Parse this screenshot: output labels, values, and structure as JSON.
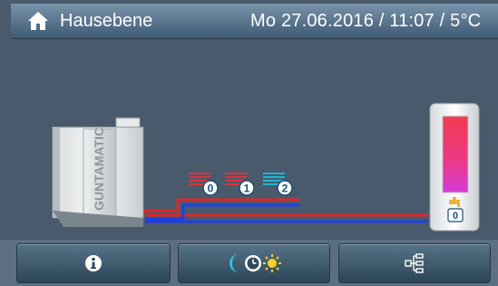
{
  "header": {
    "title": "Hausebene",
    "datetime": "Mo 27.06.2016 / 11:07 /  5°C",
    "home_icon": "home-icon"
  },
  "boiler": {
    "brand": "GUNTAMATIC"
  },
  "heating_circuits": [
    {
      "number": "0",
      "icon": "heating-circuit-icon",
      "color": "#e0303a"
    },
    {
      "number": "1",
      "icon": "heating-circuit-icon",
      "color": "#e0303a"
    },
    {
      "number": "2",
      "icon": "heating-circuit-icon",
      "color": "#1fb4d8"
    }
  ],
  "hot_water_tank": {
    "number": "0",
    "icon": "tap-icon"
  },
  "pipes": {
    "flow_color": "#e1262b",
    "return_color": "#1f3fe0"
  },
  "footer": {
    "buttons": [
      {
        "name": "info",
        "icon": "info-icon"
      },
      {
        "name": "mode",
        "icon": "moon-clock-sun-icon"
      },
      {
        "name": "overview",
        "icon": "hierarchy-icon"
      }
    ]
  }
}
